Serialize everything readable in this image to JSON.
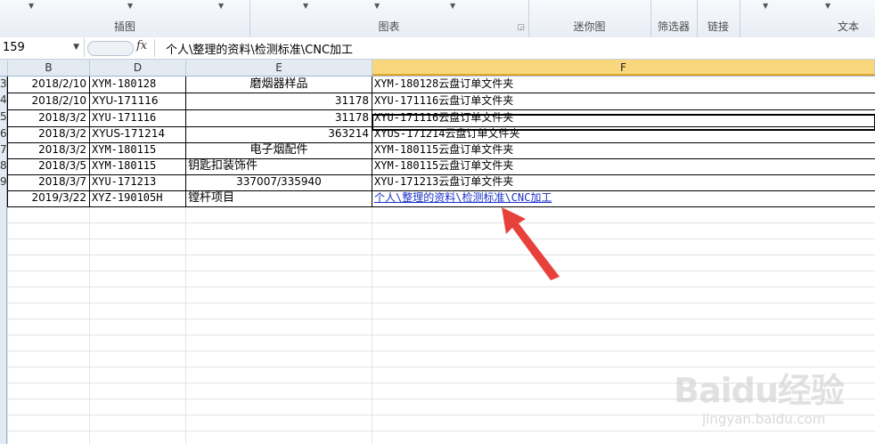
{
  "ribbon": {
    "groups": [
      {
        "label": "插图"
      },
      {
        "label": "图表"
      },
      {
        "label": "迷你图"
      },
      {
        "label": "筛选器"
      },
      {
        "label": "链接"
      },
      {
        "label": "文本"
      }
    ]
  },
  "formula_bar": {
    "name_box": "159",
    "fx_label": "fx",
    "content": "个人\\整理的资料\\检测标准\\CNC加工"
  },
  "columns": [
    "B",
    "D",
    "E",
    "F"
  ],
  "rows": [
    {
      "num": "3",
      "b": "2018/2/10",
      "d": "XYM-180128",
      "e": "磨烟器样品",
      "f": "XYM-180128云盘订单文件夹"
    },
    {
      "num": "4",
      "b": "2018/2/10",
      "d": "XYU-171116",
      "e": "31178",
      "f": "XYU-171116云盘订单文件夹"
    },
    {
      "num": "5",
      "b": "2018/3/2",
      "d": "XYU-171116",
      "e": "31178",
      "f": "XYU-171116云盘订单文件夹"
    },
    {
      "num": "6",
      "b": "2018/3/2",
      "d": "XYUS-171214",
      "e": "363214",
      "f": "XYUS-171214云盘订单文件夹"
    },
    {
      "num": "7",
      "b": "2018/3/2",
      "d": "XYM-180115",
      "e": "电子烟配件",
      "f": "XYM-180115云盘订单文件夹"
    },
    {
      "num": "8",
      "b": "2018/3/5",
      "d": "XYM-180115",
      "e": "钥匙扣装饰件",
      "f": "XYM-180115云盘订单文件夹"
    },
    {
      "num": "9",
      "b": "2018/3/7",
      "d": "XYU-171213",
      "e": "337007/335940",
      "f": "XYU-171213云盘订单文件夹"
    },
    {
      "num": "",
      "b": "2019/3/22",
      "d": "XYZ-190105H",
      "e": "镗杆项目",
      "f": "个人\\整理的资料\\检测标准\\CNC加工"
    }
  ],
  "watermark": {
    "logo": "Baidu经验",
    "sub": "jingyan.baidu.com"
  },
  "colors": {
    "active_header": "#f9d87d",
    "link": "#1a31c9",
    "arrow": "#e8403a"
  }
}
